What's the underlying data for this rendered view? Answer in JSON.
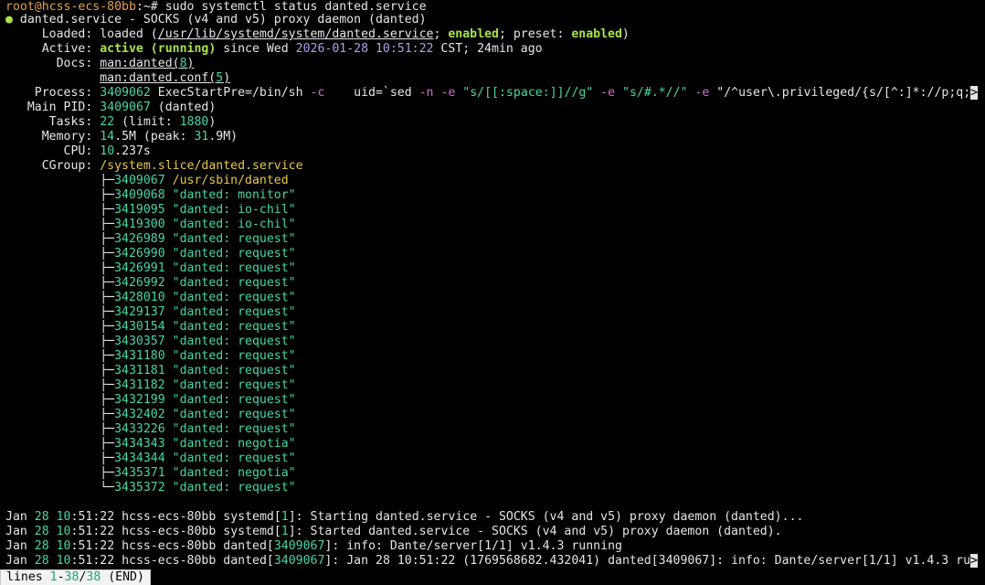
{
  "prompt": {
    "user_host": "root@hcss-ecs-80bb",
    "path_sep": ":~# ",
    "command": "sudo systemctl status danted.service"
  },
  "unit": {
    "dot": "●",
    "title": "danted.service - SOCKS (v4 and v5) proxy daemon (danted)",
    "loaded_label": "Loaded:",
    "loaded_pre": "loaded (",
    "loaded_path": "/usr/lib/systemd/system/danted.service",
    "loaded_mid": "; ",
    "loaded_enabled": "enabled",
    "loaded_preset_label": "; preset: ",
    "loaded_preset": "enabled",
    "loaded_end": ")",
    "active_label": "Active:",
    "active_state": "active (running)",
    "active_since": " since Wed ",
    "active_date": "2026-01-28 10:51:22",
    "active_tz": " CST; 24min ago",
    "docs_label": "Docs:",
    "docs_1_name": "man:danted(",
    "docs_1_num": "8",
    "docs_2_name": "man:danted.conf(",
    "docs_2_num": "5",
    "process_label": "Process:",
    "process_pid": "3409062",
    "process_text_a": " ExecStartPre=/bin/sh ",
    "process_flag_c": "-c",
    "process_text_b": "    uid=`sed ",
    "process_flag_n": "-n",
    "process_flag_e1": "-e",
    "process_str1": "\"s/[[:space:]]//g\"",
    "process_flag_e2": "-e",
    "process_str2": "\"s/#.*//\"",
    "process_flag_e3": "-e",
    "process_text_c": " \"/^user\\.privileged/{s/[^:]*://p;q;",
    "process_trunc": ">",
    "mainpid_label": "Main PID:",
    "mainpid_num": "3409067",
    "mainpid_name": " (danted)",
    "tasks_label": "Tasks:",
    "tasks_num": "22",
    "tasks_limit_pre": " (limit: ",
    "tasks_limit": "1880",
    "tasks_limit_end": ")",
    "memory_label": "Memory:",
    "memory_a": "14",
    "memory_b": ".5M (peak: ",
    "memory_c": "31",
    "memory_d": ".9M)",
    "cpu_label": "CPU:",
    "cpu_a": "10",
    "cpu_b": ".237s",
    "cgroup_label": "CGroup:",
    "cgroup_path": "/system.slice/danted.service"
  },
  "cgroup_procs": [
    {
      "tree": "├─",
      "pid": "3409067",
      "name": " /usr/sbin/danted",
      "is_path": true
    },
    {
      "tree": "├─",
      "pid": "3409068",
      "name": " \"danted: monitor\""
    },
    {
      "tree": "├─",
      "pid": "3419095",
      "name": " \"danted: io-chil\""
    },
    {
      "tree": "├─",
      "pid": "3419300",
      "name": " \"danted: io-chil\""
    },
    {
      "tree": "├─",
      "pid": "3426989",
      "name": " \"danted: request\""
    },
    {
      "tree": "├─",
      "pid": "3426990",
      "name": " \"danted: request\""
    },
    {
      "tree": "├─",
      "pid": "3426991",
      "name": " \"danted: request\""
    },
    {
      "tree": "├─",
      "pid": "3426992",
      "name": " \"danted: request\""
    },
    {
      "tree": "├─",
      "pid": "3428010",
      "name": " \"danted: request\""
    },
    {
      "tree": "├─",
      "pid": "3429137",
      "name": " \"danted: request\""
    },
    {
      "tree": "├─",
      "pid": "3430154",
      "name": " \"danted: request\""
    },
    {
      "tree": "├─",
      "pid": "3430357",
      "name": " \"danted: request\""
    },
    {
      "tree": "├─",
      "pid": "3431180",
      "name": " \"danted: request\""
    },
    {
      "tree": "├─",
      "pid": "3431181",
      "name": " \"danted: request\""
    },
    {
      "tree": "├─",
      "pid": "3431182",
      "name": " \"danted: request\""
    },
    {
      "tree": "├─",
      "pid": "3432199",
      "name": " \"danted: request\""
    },
    {
      "tree": "├─",
      "pid": "3432402",
      "name": " \"danted: request\""
    },
    {
      "tree": "├─",
      "pid": "3433226",
      "name": " \"danted: request\""
    },
    {
      "tree": "├─",
      "pid": "3434343",
      "name": " \"danted: negotia\""
    },
    {
      "tree": "├─",
      "pid": "3434344",
      "name": " \"danted: request\""
    },
    {
      "tree": "├─",
      "pid": "3435371",
      "name": " \"danted: negotia\""
    },
    {
      "tree": "└─",
      "pid": "3435372",
      "name": " \"danted: request\""
    }
  ],
  "logs": [
    {
      "mon": "Jan ",
      "day": "28",
      "sp": " ",
      "time_a": "10",
      "time_b": ":51:22 ",
      "host_a": "hcss-",
      "host_b": "ecs-80bb",
      "proc": " systemd[",
      "pid": "1",
      "rest": "]: Starting danted.service - SOCKS (v4 and v5) proxy daemon (danted)..."
    },
    {
      "mon": "Jan ",
      "day": "28",
      "sp": " ",
      "time_a": "10",
      "time_b": ":51:22 ",
      "host_a": "hcss-",
      "host_b": "ecs-80bb",
      "proc": " systemd[",
      "pid": "1",
      "rest": "]: Started danted.service - SOCKS (v4 and v5) proxy daemon (danted)."
    },
    {
      "mon": "Jan ",
      "day": "28",
      "sp": " ",
      "time_a": "10",
      "time_b": ":51:22 ",
      "host_a": "hcss-",
      "host_b": "ecs-80bb",
      "proc": " danted[",
      "pid": "3409067",
      "rest": "]: info: Dante/server[1/1] v1.4.3 running"
    },
    {
      "mon": "Jan ",
      "day": "28",
      "sp": " ",
      "time_a": "10",
      "time_b": ":51:22 ",
      "host_a": "hcss-",
      "host_b": "ecs-80bb",
      "proc": " danted[",
      "pid": "3409067",
      "rest": "]: Jan 28 10:51:22 (1769568682.432041) danted[3409067]: info: Dante/server[1/1] v1.4.3 ru",
      "trunc": ">"
    }
  ],
  "pager": {
    "pre": "lines ",
    "from": "1",
    "dash": "-",
    "to": "38",
    "slash": "/",
    "total": "38",
    "end": " (END)"
  }
}
